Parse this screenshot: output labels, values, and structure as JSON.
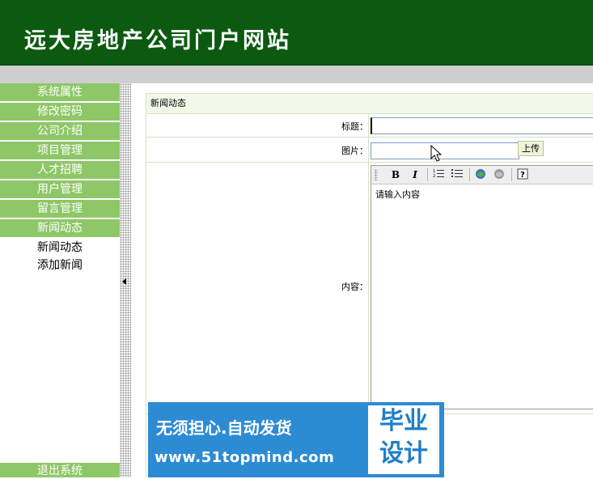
{
  "header": {
    "title": "远大房地产公司门户网站"
  },
  "sidebar": {
    "items": [
      {
        "label": "系统属性"
      },
      {
        "label": "修改密码"
      },
      {
        "label": "公司介绍"
      },
      {
        "label": "项目管理"
      },
      {
        "label": "人才招聘"
      },
      {
        "label": "用户管理"
      },
      {
        "label": "留言管理"
      },
      {
        "label": "新闻动态"
      }
    ],
    "subitems": [
      {
        "label": "新闻动态"
      },
      {
        "label": "添加新闻"
      }
    ],
    "logout": "退出系统"
  },
  "panel": {
    "title": "新闻动态",
    "fields": {
      "title_label": "标题：",
      "image_label": "图片：",
      "content_label": "内容："
    },
    "upload_button": "上传",
    "editor": {
      "placeholder": "请输入内容",
      "toolbar": {
        "bold": "B",
        "italic": "I"
      }
    }
  },
  "watermark": {
    "slogan": "无须担心.自动发货",
    "url": "www.51topmind.com",
    "badge_line1": "毕业",
    "badge_line2": "设计"
  },
  "colors": {
    "header_bg": "#0b5a10",
    "menu_bg": "#8ec767",
    "watermark_bg": "#2d8bd4"
  }
}
